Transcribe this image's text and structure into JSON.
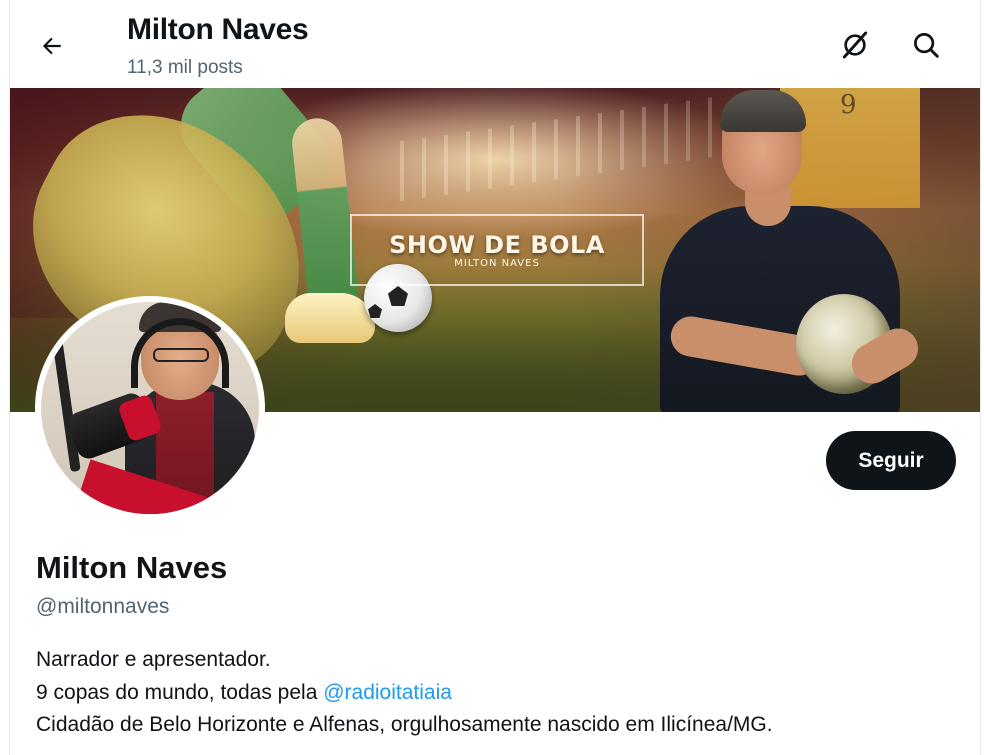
{
  "header": {
    "title": "Milton Naves",
    "post_count": "11,3 mil posts",
    "icons": [
      "back-arrow-icon",
      "crossed-spark-icon",
      "search-icon"
    ]
  },
  "banner": {
    "title": "SHOW DE BOLA",
    "subtitle": "MILTON NAVES",
    "trophy_number": "9"
  },
  "profile": {
    "follow_label": "Seguir",
    "name": "Milton Naves",
    "handle": "@miltonnaves",
    "bio_line1": "Narrador e apresentador.",
    "bio_line2_prefix": "9 copas do mundo, todas pela ",
    "bio_line2_link": "@radioitatiaia",
    "bio_line3": "Cidadão de Belo Horizonte e Alfenas, orgulhosamente nascido em Ilicínea/MG."
  },
  "colors": {
    "text_primary": "#0f1419",
    "text_secondary": "#536471",
    "link": "#1d9bf0",
    "button_bg": "#0f1419"
  }
}
